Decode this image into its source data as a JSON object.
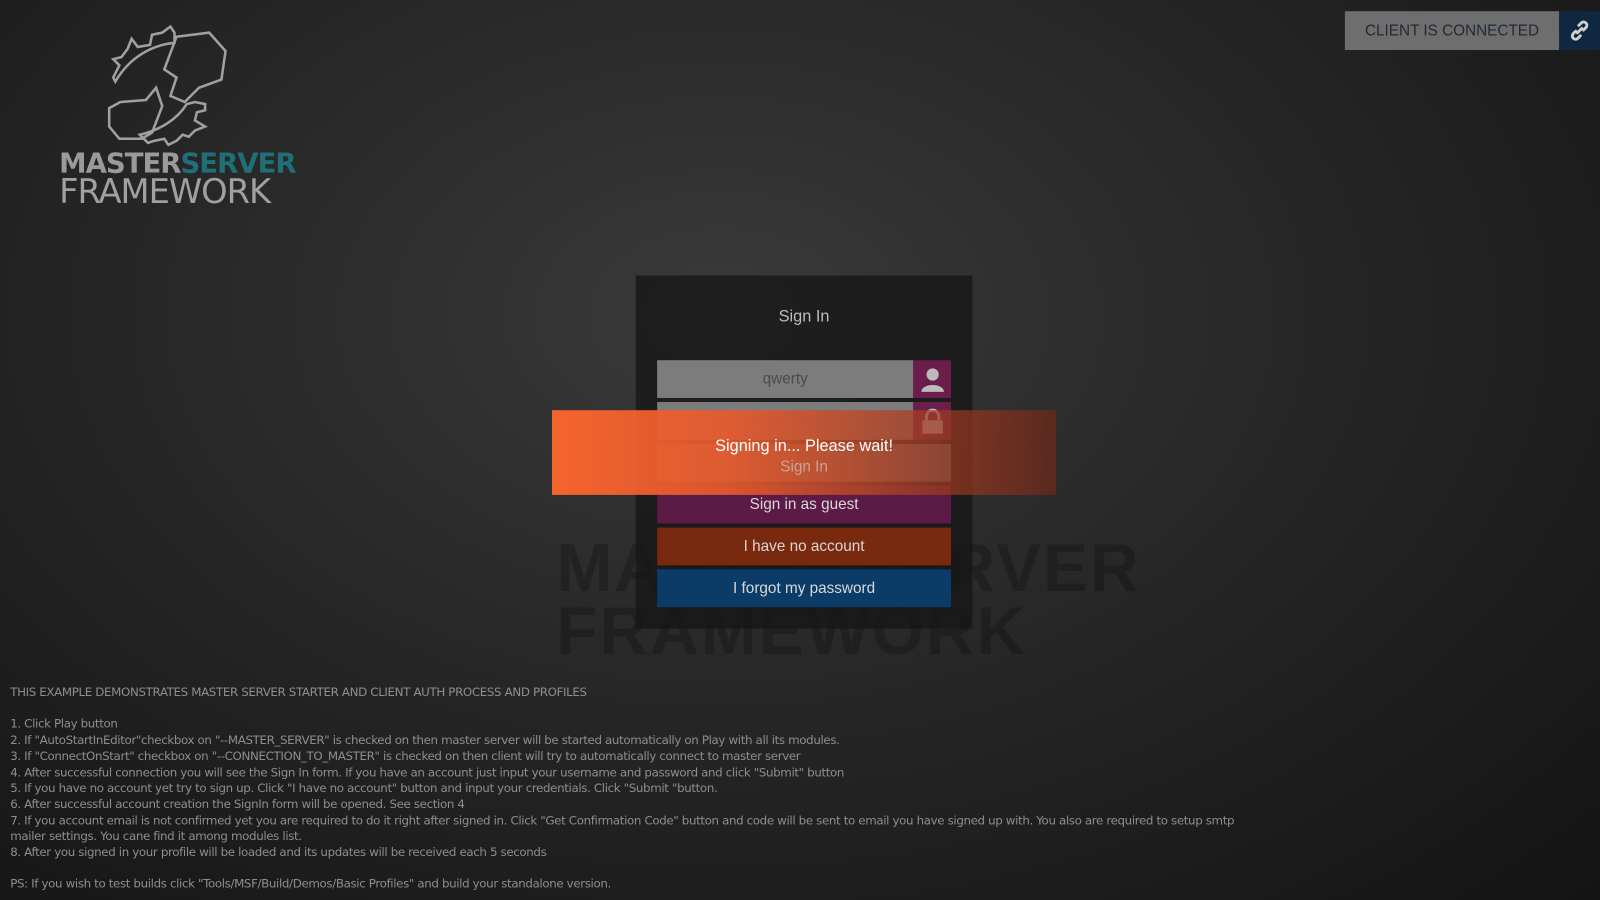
{
  "logo": {
    "word1a": "MASTER",
    "word1b": "SERVER",
    "word2": "FRAMEWORK",
    "accent": "#1f6f78"
  },
  "status": {
    "label": "CLIENT IS CONNECTED",
    "icon": "link-icon"
  },
  "signin": {
    "title": "Sign In",
    "username_value": "qwerty",
    "password_value": "**************",
    "username_icon": "user-icon",
    "password_icon": "lock-icon",
    "signin_label": "Sign In",
    "guest_label": "Sign in as guest",
    "no_account_label": "I have no account",
    "forgot_label": "I forgot my password"
  },
  "overlay": {
    "message": "Signing in... Please wait!"
  },
  "info": {
    "heading": "THIS EXAMPLE DEMONSTRATES MASTER SERVER STARTER AND CLIENT AUTH PROCESS AND PROFILES",
    "steps": [
      "1. Click Play button",
      "2. If \"AutoStartInEditor\"checkbox on \"--MASTER_SERVER\" is checked on then master server will be started automatically on Play with all its modules.",
      "3. If \"ConnectOnStart\" checkbox on \"--CONNECTION_TO_MASTER\" is checked on then client will try to automatically connect to master server",
      "4. After successful connection you will see the Sign In form. If you have an account just input your username and password and click \"Submit\" button",
      "5. If you have no account yet try to sign up. Click \"I have no account\" button and input your credentials. Click \"Submit \"button.",
      "6. After successful account creation the SignIn form will be opened. See section 4",
      "7. If you account email is not confirmed yet you are required to do it right after signed in. Click \"Get Confirmation Code\" button and code will be sent to email you have signed up with. You also are required to setup smtp mailer settings. You cane find it among modules list.",
      "8. After you signed in your profile will be loaded and its updates will be received each 5 seconds"
    ],
    "ps": "PS: If you wish to test builds click \"Tools/MSF/Build/Demos/Basic Profiles\" and build your standalone version."
  }
}
